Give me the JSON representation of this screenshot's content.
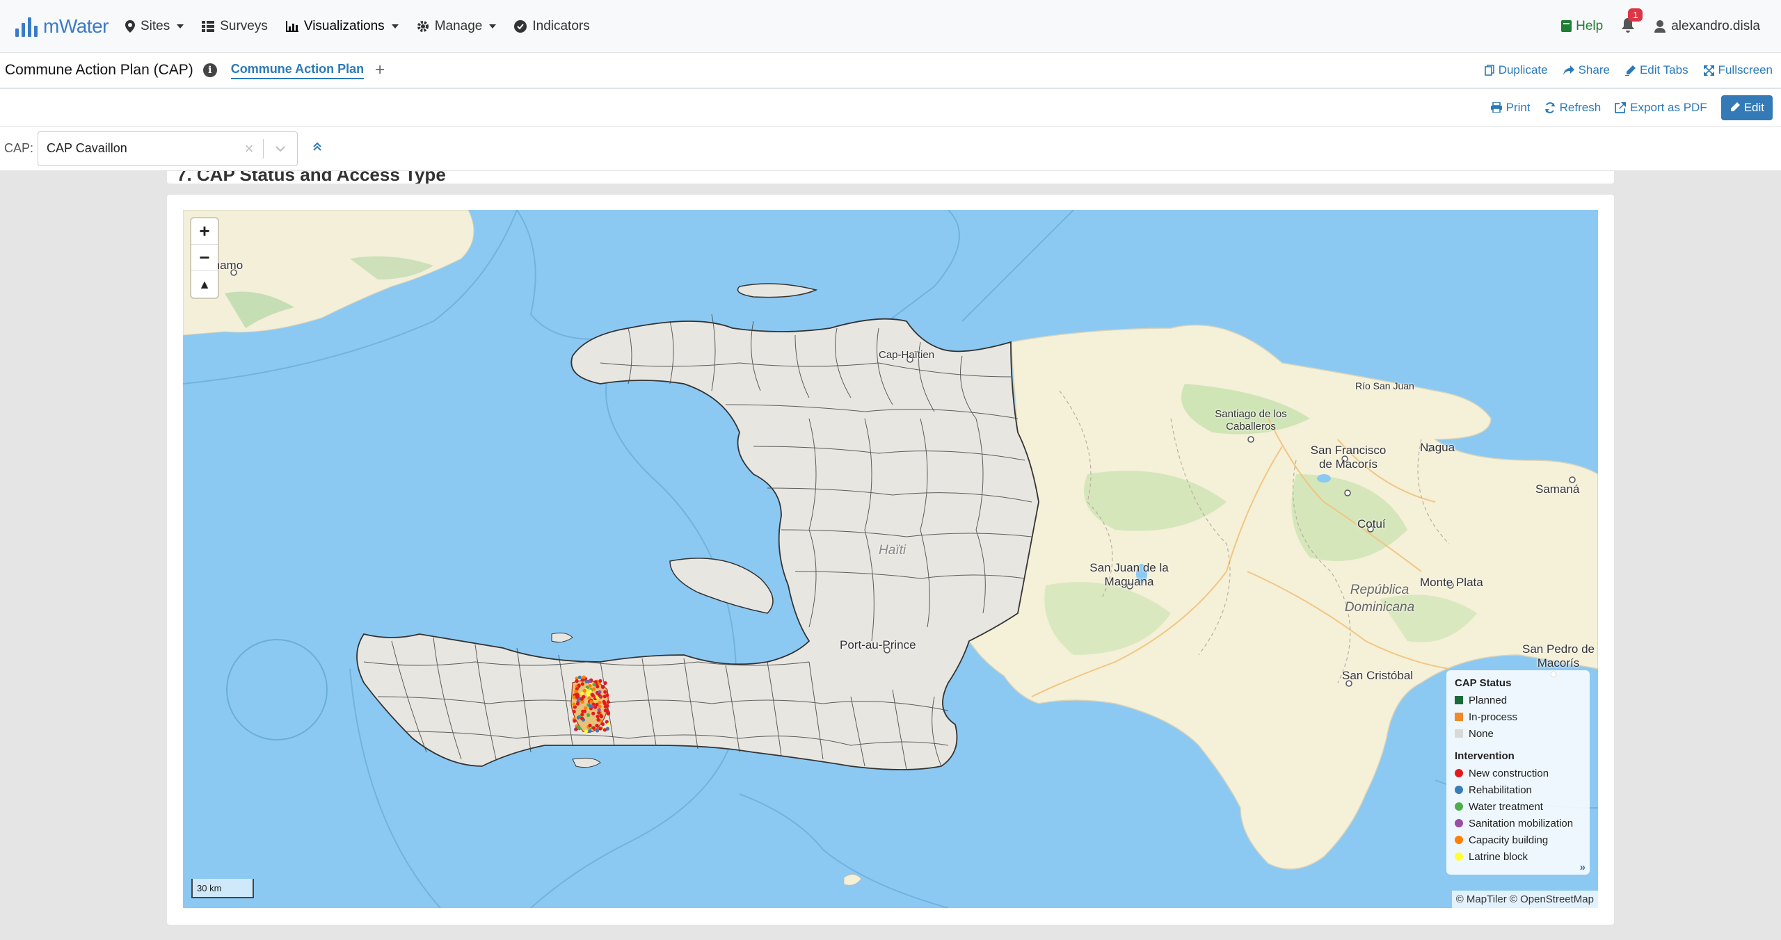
{
  "navbar": {
    "brand": "mWater",
    "items": [
      {
        "label": "Sites",
        "icon": "map-marker-icon",
        "dropdown": true
      },
      {
        "label": "Surveys",
        "icon": "list-icon",
        "dropdown": false
      },
      {
        "label": "Visualizations",
        "icon": "bar-chart-icon",
        "dropdown": true
      },
      {
        "label": "Manage",
        "icon": "gear-icon",
        "dropdown": true
      },
      {
        "label": "Indicators",
        "icon": "check-circle-icon",
        "dropdown": false
      }
    ],
    "help_label": "Help",
    "notification_count": "1",
    "user": "alexandro.disla"
  },
  "tabbar": {
    "dashboard_title": "Commune Action Plan (CAP)",
    "active_tab": "Commune Action Plan",
    "add_tab": "+",
    "duplicate": "Duplicate",
    "share": "Share",
    "edit_tabs": "Edit Tabs",
    "fullscreen": "Fullscreen"
  },
  "actionbar": {
    "print": "Print",
    "refresh": "Refresh",
    "export_pdf": "Export as PDF",
    "edit": "Edit"
  },
  "filter": {
    "label": "CAP:",
    "value": "CAP Cavaillon",
    "clear": "×"
  },
  "widget": {
    "partial_heading": "7. CAP Status and Access Type"
  },
  "map": {
    "zoom_in": "+",
    "zoom_out": "−",
    "compass": "▲",
    "scale": "30 km",
    "attribution": "© MapTiler © OpenStreetMap",
    "labels": {
      "guantanamo": "ntánamo",
      "cap_haitien": "Cap-Haïtien",
      "santiago": "Santiago de los Caballeros",
      "rio_san_juan": "Río San Juan",
      "san_francisco": "San Francisco de Macorís",
      "nagua": "Nagua",
      "samana": "Samaná",
      "cotui": "Cotuí",
      "haiti": "Haïti",
      "san_juan": "San Juan de la Maguana",
      "rep_dom": "República Dominicana",
      "monte_plata": "Monte Plata",
      "port_au_prince": "Port-au-Prince",
      "san_pedro": "San Pedro de Macorís",
      "san_cristobal": "San Cristóbal"
    },
    "legend": {
      "status_title": "CAP Status",
      "status_items": [
        {
          "label": "Planned",
          "color": "#1a6b3a"
        },
        {
          "label": "In-process",
          "color": "#f08a2a"
        },
        {
          "label": "None",
          "color": "#d9d9d9"
        }
      ],
      "intervention_title": "Intervention",
      "intervention_items": [
        {
          "label": "New construction",
          "color": "#e31a1c"
        },
        {
          "label": "Rehabilitation",
          "color": "#377eb8"
        },
        {
          "label": "Water treatment",
          "color": "#4daf4a"
        },
        {
          "label": "Sanitation mobilization",
          "color": "#984ea3"
        },
        {
          "label": "Capacity building",
          "color": "#ff7f00"
        },
        {
          "label": "Latrine block",
          "color": "#ffff33"
        }
      ],
      "more": "»"
    }
  }
}
